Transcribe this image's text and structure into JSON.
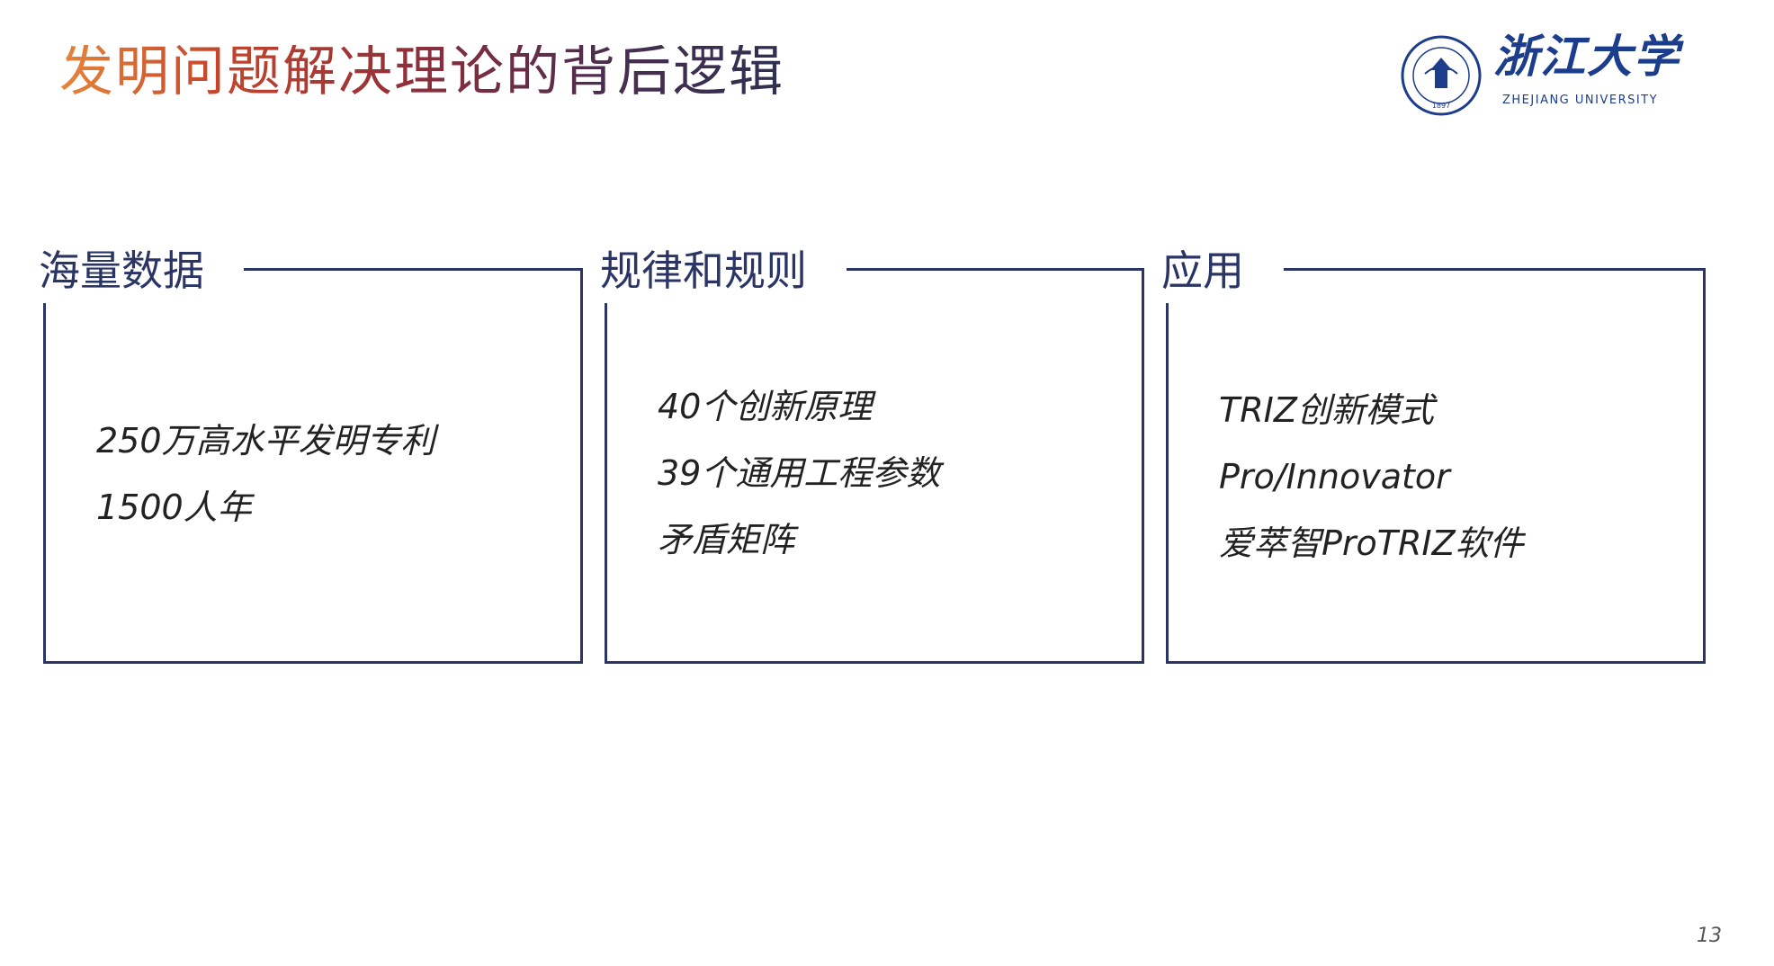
{
  "slide": {
    "title": "发明问题解决理论的背后逻辑",
    "page_number": "13"
  },
  "logo": {
    "name_cn": "浙江大学",
    "name_en": "ZHEJIANG UNIVERSITY",
    "seal_year": "1897",
    "color": "#1c3d8c"
  },
  "boxes": [
    {
      "label": "海量数据",
      "items": [
        "250万高水平发明专利",
        "1500人年"
      ]
    },
    {
      "label": "规律和规则",
      "items": [
        "40个创新原理",
        "39个通用工程参数",
        "矛盾矩阵"
      ]
    },
    {
      "label": "应用",
      "items": [
        "TRIZ创新模式",
        "Pro/Innovator",
        "爱萃智ProTRIZ软件"
      ]
    }
  ],
  "colors": {
    "box_border": "#2a3566",
    "title_gradient_start": "#e6863a",
    "title_gradient_end": "#2e3050"
  }
}
